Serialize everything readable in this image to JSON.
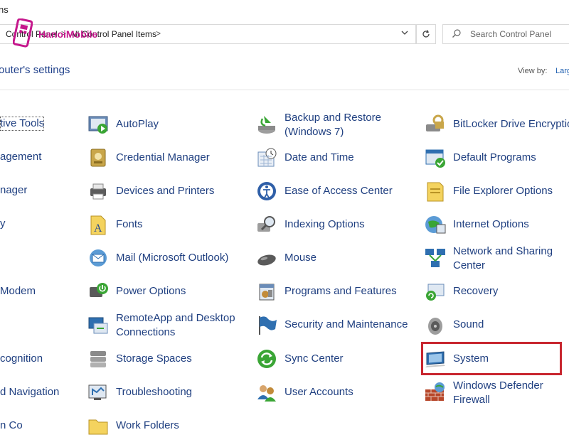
{
  "window": {
    "title_fragment": "ns"
  },
  "address": {
    "crumbs": [
      "Control Panel",
      "All Control Panel Items"
    ],
    "separator": ">"
  },
  "search": {
    "placeholder": "Search Control Panel"
  },
  "watermark": {
    "text": "HanoiMobile"
  },
  "header": {
    "title": "outer's settings",
    "view_by_label": "View by:",
    "view_by_value": "Larg"
  },
  "colors": {
    "link": "#1f3f80",
    "heading": "#1e3f8a",
    "highlight": "#c8262f",
    "watermark": "#c5178c"
  },
  "columns": [
    {
      "items": [
        {
          "label": "tive Tools"
        },
        {
          "label": "agement"
        },
        {
          "label": "nager"
        },
        {
          "label": "y"
        },
        {
          "label": ""
        },
        {
          "label": "Modem"
        },
        {
          "label": ""
        },
        {
          "label": "cognition"
        },
        {
          "label": "d Navigation"
        },
        {
          "label": "n Co"
        }
      ]
    },
    {
      "items": [
        {
          "label": "AutoPlay",
          "icon": "autoplay-icon"
        },
        {
          "label": "Credential Manager",
          "icon": "credential-manager-icon"
        },
        {
          "label": "Devices and Printers",
          "icon": "printer-icon"
        },
        {
          "label": "Fonts",
          "icon": "fonts-icon"
        },
        {
          "label": "Mail (Microsoft Outlook)",
          "icon": "mail-icon"
        },
        {
          "label": "Power Options",
          "icon": "power-icon"
        },
        {
          "label": "RemoteApp and Desktop Connections",
          "line1": "RemoteApp and Desktop",
          "line2": "Connections",
          "icon": "remoteapp-icon"
        },
        {
          "label": "Storage Spaces",
          "icon": "storage-icon"
        },
        {
          "label": "Troubleshooting",
          "icon": "troubleshoot-icon"
        },
        {
          "label": "Work Folders",
          "icon": "work-folders-icon"
        }
      ]
    },
    {
      "items": [
        {
          "label": "Backup and Restore (Windows 7)",
          "line1": "Backup and Restore",
          "line2": "(Windows 7)",
          "icon": "backup-icon"
        },
        {
          "label": "Date and Time",
          "icon": "clock-icon"
        },
        {
          "label": "Ease of Access Center",
          "icon": "ease-of-access-icon"
        },
        {
          "label": "Indexing Options",
          "icon": "indexing-icon"
        },
        {
          "label": "Mouse",
          "icon": "mouse-icon"
        },
        {
          "label": "Programs and Features",
          "icon": "programs-icon"
        },
        {
          "label": "Security and Maintenance",
          "icon": "flag-icon"
        },
        {
          "label": "Sync Center",
          "icon": "sync-icon"
        },
        {
          "label": "User Accounts",
          "icon": "users-icon"
        }
      ]
    },
    {
      "items": [
        {
          "label": "BitLocker Drive Encryptio",
          "icon": "bitlocker-icon"
        },
        {
          "label": "Default Programs",
          "icon": "default-programs-icon"
        },
        {
          "label": "File Explorer Options",
          "icon": "folder-options-icon"
        },
        {
          "label": "Internet Options",
          "icon": "internet-icon"
        },
        {
          "label": "Network and Sharing Center",
          "line1": "Network and Sharing",
          "line2": "Center",
          "icon": "network-icon"
        },
        {
          "label": "Recovery",
          "icon": "recovery-icon"
        },
        {
          "label": "Sound",
          "icon": "speaker-icon"
        },
        {
          "label": "System",
          "icon": "system-monitor-icon"
        },
        {
          "label": "Windows Defender Firewall",
          "line1": "Windows Defender",
          "line2": "Firewall",
          "icon": "firewall-icon"
        }
      ]
    }
  ]
}
